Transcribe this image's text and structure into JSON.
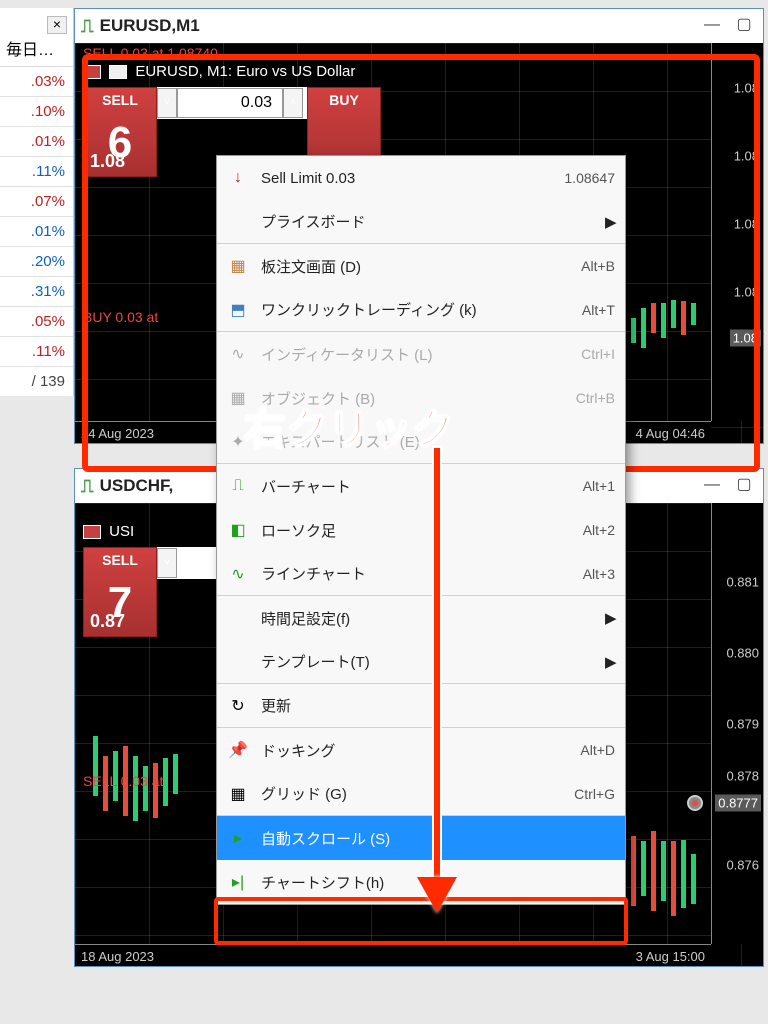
{
  "sidebar": {
    "close_glyph": "×",
    "header": "毎日…",
    "rows": [
      {
        "value": ".03%",
        "sign": "neg"
      },
      {
        "value": ".10%",
        "sign": "neg"
      },
      {
        "value": ".01%",
        "sign": "neg"
      },
      {
        "value": ".11%",
        "sign": "pos"
      },
      {
        "value": ".07%",
        "sign": "neg"
      },
      {
        "value": ".01%",
        "sign": "pos"
      },
      {
        "value": ".20%",
        "sign": "pos"
      },
      {
        "value": ".31%",
        "sign": "pos"
      },
      {
        "value": ".05%",
        "sign": "neg"
      },
      {
        "value": ".11%",
        "sign": "neg"
      }
    ],
    "footer": "/ 139"
  },
  "windows": [
    {
      "title": "EURUSD,M1",
      "instrument_line": "EURUSD, M1: Euro vs US Dollar",
      "order_sell": "SELL 0.03 at 1.08740",
      "order_buy": "BUY 0.03 at",
      "trade": {
        "sell": "SELL",
        "buy": "BUY",
        "volume": "0.03",
        "sell_big": "6",
        "buy_big": "",
        "sell_sub": "1.08"
      },
      "y_ticks": [
        "1.08",
        "1.08",
        "1.08",
        "1.08",
        "1.08"
      ],
      "x_left": "24 Aug 2023",
      "x_right": "4 Aug 04:46"
    },
    {
      "title": "USDCHF,",
      "instrument_line": "USI",
      "order_sell": "SELL 0.03 at",
      "trade": {
        "sell": "SELL",
        "sell_big": "7",
        "sell_sub": "0.87"
      },
      "y_ticks": [
        "0.881",
        "0.880",
        "0.879",
        "0.878",
        "0.8777",
        "0.876"
      ],
      "x_left": "18 Aug 2023",
      "x_right": "3 Aug 15:00"
    }
  ],
  "context_menu": {
    "items": [
      {
        "icon": "↓",
        "icon_color": "#c02020",
        "label": "Sell Limit 0.03",
        "shortcut": "1.08647",
        "sep": false
      },
      {
        "icon": "",
        "label": "プライスボード",
        "submenu": true,
        "sep": true
      },
      {
        "icon": "▦",
        "icon_color": "#c08040",
        "label": "板注文画面 (D)",
        "shortcut": "Alt+B"
      },
      {
        "icon": "⬒",
        "icon_color": "#4080c0",
        "label": "ワンクリックトレーディング (k)",
        "shortcut": "Alt+T",
        "sep": true
      },
      {
        "icon": "∿",
        "label": "インディケータリスト (L)",
        "shortcut": "Ctrl+I",
        "disabled": true
      },
      {
        "icon": "▦",
        "label": "オブジェクト (B)",
        "shortcut": "Ctrl+B",
        "disabled": true
      },
      {
        "icon": "✦",
        "label": "エキスパートリスト (E)",
        "disabled": true,
        "sep": true
      },
      {
        "icon": "⎍",
        "icon_color": "#20a020",
        "label": "バーチャート",
        "shortcut": "Alt+1"
      },
      {
        "icon": "◧",
        "icon_color": "#20a020",
        "label": "ローソク足",
        "shortcut": "Alt+2"
      },
      {
        "icon": "∿",
        "icon_color": "#20a020",
        "label": "ラインチャート",
        "shortcut": "Alt+3",
        "sep": true
      },
      {
        "icon": "",
        "label": "時間足設定(f)",
        "submenu": true
      },
      {
        "icon": "",
        "label": "テンプレート(T)",
        "submenu": true,
        "sep": true
      },
      {
        "icon": "↻",
        "label": "更新",
        "sep": true
      },
      {
        "icon": "📌",
        "label": "ドッキング",
        "shortcut": "Alt+D"
      },
      {
        "icon": "▦",
        "label": "グリッド (G)",
        "shortcut": "Ctrl+G",
        "sep": true
      },
      {
        "icon": "▸",
        "icon_color": "#20a020",
        "label": "自動スクロール (S)",
        "selected": true
      },
      {
        "icon": "▸|",
        "icon_color": "#20a020",
        "label": "チャートシフト(h)"
      }
    ]
  },
  "annotation": {
    "text": "右クリック"
  },
  "chart_data": [
    {
      "type": "candlestick",
      "instrument": "EURUSD",
      "timeframe": "M1",
      "ylim": [
        1.082,
        1.088
      ],
      "x_range": [
        "24 Aug 2023",
        "24 Aug 04:46"
      ],
      "note": "Price scale at right shows repeating label 1.08 (truncated). Highlighted price 1.08 on axis."
    },
    {
      "type": "candlestick",
      "instrument": "USDCHF",
      "timeframe": "M1",
      "ylim": [
        0.876,
        0.882
      ],
      "y_ticks": [
        0.876,
        0.8777,
        0.878,
        0.879,
        0.88,
        0.881
      ],
      "x_range": [
        "18 Aug 2023",
        "23 Aug 15:00"
      ],
      "highlighted_price": 0.8777
    }
  ]
}
